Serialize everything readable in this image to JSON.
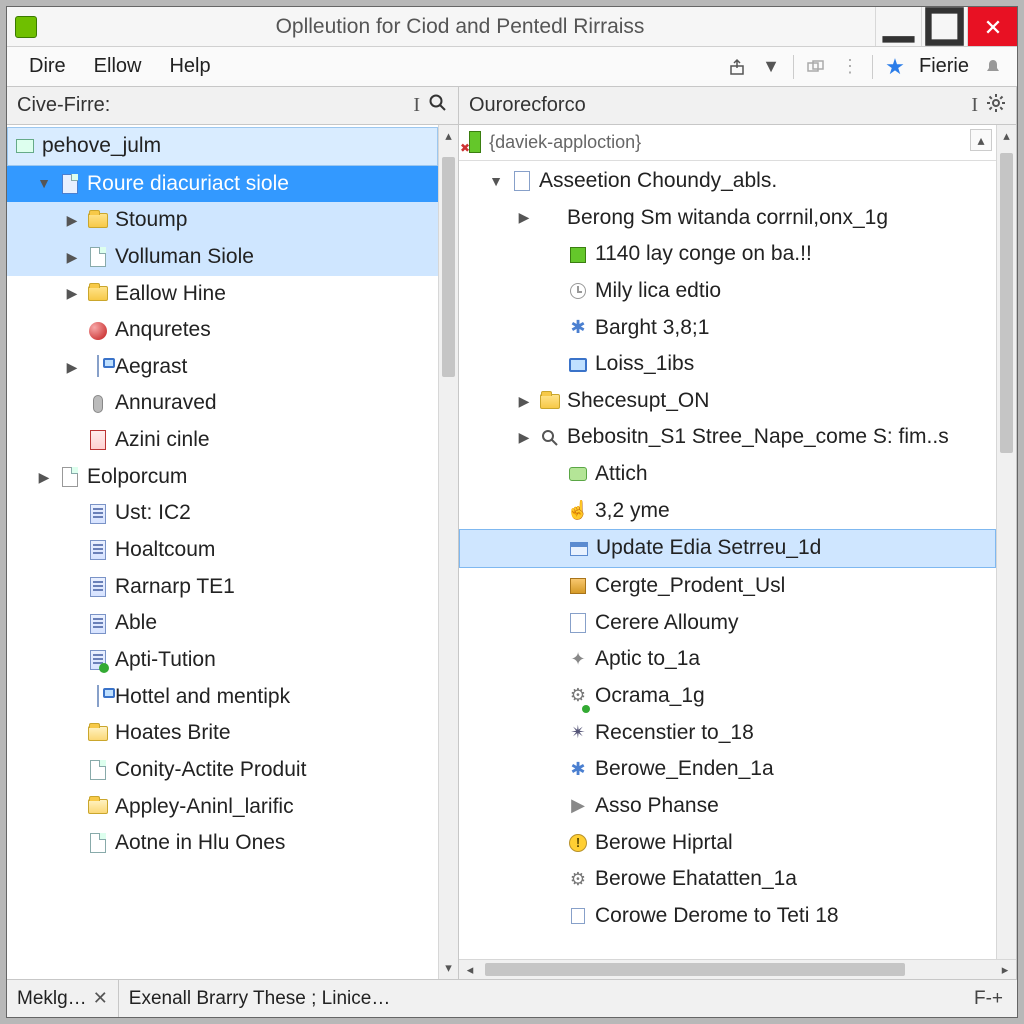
{
  "window": {
    "title": "Oplleution for Ciod and Pentedl Rirraiss"
  },
  "menubar": {
    "items": [
      "Dire",
      "Ellow",
      "Help"
    ],
    "toolbar_label": "Fierie"
  },
  "panes": {
    "left": {
      "title": "Cive-Firre:"
    },
    "right": {
      "title": "Ourorecforco"
    }
  },
  "left_tree": {
    "root": "pehove_julm",
    "items": [
      {
        "label": "Roure diacuriact siole",
        "depth": 1,
        "twisty": "down",
        "icon": "page-blue",
        "selected": true
      },
      {
        "label": "Stoump",
        "depth": 2,
        "twisty": "right",
        "icon": "folder",
        "band": true
      },
      {
        "label": "Volluman Siole",
        "depth": 2,
        "twisty": "right",
        "icon": "page",
        "band": true
      },
      {
        "label": "Eallow Hine",
        "depth": 2,
        "twisty": "right",
        "icon": "folder"
      },
      {
        "label": "Anquretes",
        "depth": 2,
        "twisty": "",
        "icon": "dot-red"
      },
      {
        "label": "Aegrast",
        "depth": 2,
        "twisty": "right",
        "icon": "monitor-note"
      },
      {
        "label": "Annuraved",
        "depth": 2,
        "twisty": "",
        "icon": "mic"
      },
      {
        "label": "Azini cinle",
        "depth": 2,
        "twisty": "",
        "icon": "doc-red"
      },
      {
        "label": "Eolporcum",
        "depth": 1,
        "twisty": "right",
        "icon": "page-grey"
      },
      {
        "label": "Ust: IC2",
        "depth": 2,
        "twisty": "",
        "icon": "doc"
      },
      {
        "label": "Hoaltcoum",
        "depth": 2,
        "twisty": "",
        "icon": "doc"
      },
      {
        "label": "Rarnarp TE1",
        "depth": 2,
        "twisty": "",
        "icon": "doc"
      },
      {
        "label": "Able",
        "depth": 2,
        "twisty": "",
        "icon": "doc"
      },
      {
        "label": "Apti-Tution",
        "depth": 2,
        "twisty": "",
        "icon": "doc-badge"
      },
      {
        "label": "Hottel and mentipk",
        "depth": 2,
        "twisty": "",
        "icon": "monitor-note"
      },
      {
        "label": "Hoates Brite",
        "depth": 2,
        "twisty": "",
        "icon": "folder-open"
      },
      {
        "label": "Conity-Actite Produit",
        "depth": 2,
        "twisty": "",
        "icon": "page"
      },
      {
        "label": "Appley-Aninl_larific",
        "depth": 2,
        "twisty": "",
        "icon": "folder-open"
      },
      {
        "label": "Aotne in Hlu Ones",
        "depth": 2,
        "twisty": "",
        "icon": "page"
      }
    ]
  },
  "right_header": {
    "label": "{daviek-apploction}"
  },
  "right_tree": {
    "items": [
      {
        "label": "Asseetion Choundy_abls.",
        "depth": 1,
        "twisty": "down",
        "icon": "note"
      },
      {
        "label": "Berong Sm witanda corrnil,onx_1g",
        "depth": 2,
        "twisty": "right",
        "icon": ""
      },
      {
        "label": "1140 lay conge on ba.!!",
        "depth": 3,
        "twisty": "",
        "icon": "green-sq"
      },
      {
        "label": "Mily lica edtio",
        "depth": 3,
        "twisty": "",
        "icon": "clock"
      },
      {
        "label": "Barght 3,8;1",
        "depth": 3,
        "twisty": "",
        "icon": "molecule"
      },
      {
        "label": "Loiss_1ibs",
        "depth": 3,
        "twisty": "",
        "icon": "monitor"
      },
      {
        "label": "Shecesupt_ON",
        "depth": 2,
        "twisty": "right",
        "icon": "folder"
      },
      {
        "label": "Bebositn_S1 Stree_Nape_come S: fim..s",
        "depth": 2,
        "twisty": "right",
        "icon": "magnifier"
      },
      {
        "label": "Attich",
        "depth": 3,
        "twisty": "",
        "icon": "bubble"
      },
      {
        "label": "3,2 yme",
        "depth": 3,
        "twisty": "",
        "icon": "hand"
      },
      {
        "label": "Update Edia Setrreu_1d",
        "depth": 3,
        "twisty": "",
        "icon": "window",
        "selected_light": true
      },
      {
        "label": "Cergte_Prodent_Usl",
        "depth": 3,
        "twisty": "",
        "icon": "orange-cube"
      },
      {
        "label": "Cerere Alloumy",
        "depth": 3,
        "twisty": "",
        "icon": "note"
      },
      {
        "label": "Aptic to_1a",
        "depth": 3,
        "twisty": "",
        "icon": "tool"
      },
      {
        "label": "Ocrama_1g",
        "depth": 3,
        "twisty": "",
        "icon": "gear-badge"
      },
      {
        "label": "Recenstier to_18",
        "depth": 3,
        "twisty": "",
        "icon": "compass"
      },
      {
        "label": "Berowe_Enden_1a",
        "depth": 3,
        "twisty": "",
        "icon": "molecule"
      },
      {
        "label": "Asso Phanse",
        "depth": 3,
        "twisty": "",
        "icon": "play"
      },
      {
        "label": "Berowe Hiprtal",
        "depth": 3,
        "twisty": "",
        "icon": "warn"
      },
      {
        "label": "Berowe Ehatatten_1a",
        "depth": 3,
        "twisty": "",
        "icon": "gear"
      },
      {
        "label": "Corowe Derome to Teti 18",
        "depth": 3,
        "twisty": "",
        "icon": "note-small"
      }
    ]
  },
  "statusbar": {
    "tab1": "Meklg…",
    "tab2": "Exenall Brarry These ; Linice…",
    "right": "F-+"
  }
}
